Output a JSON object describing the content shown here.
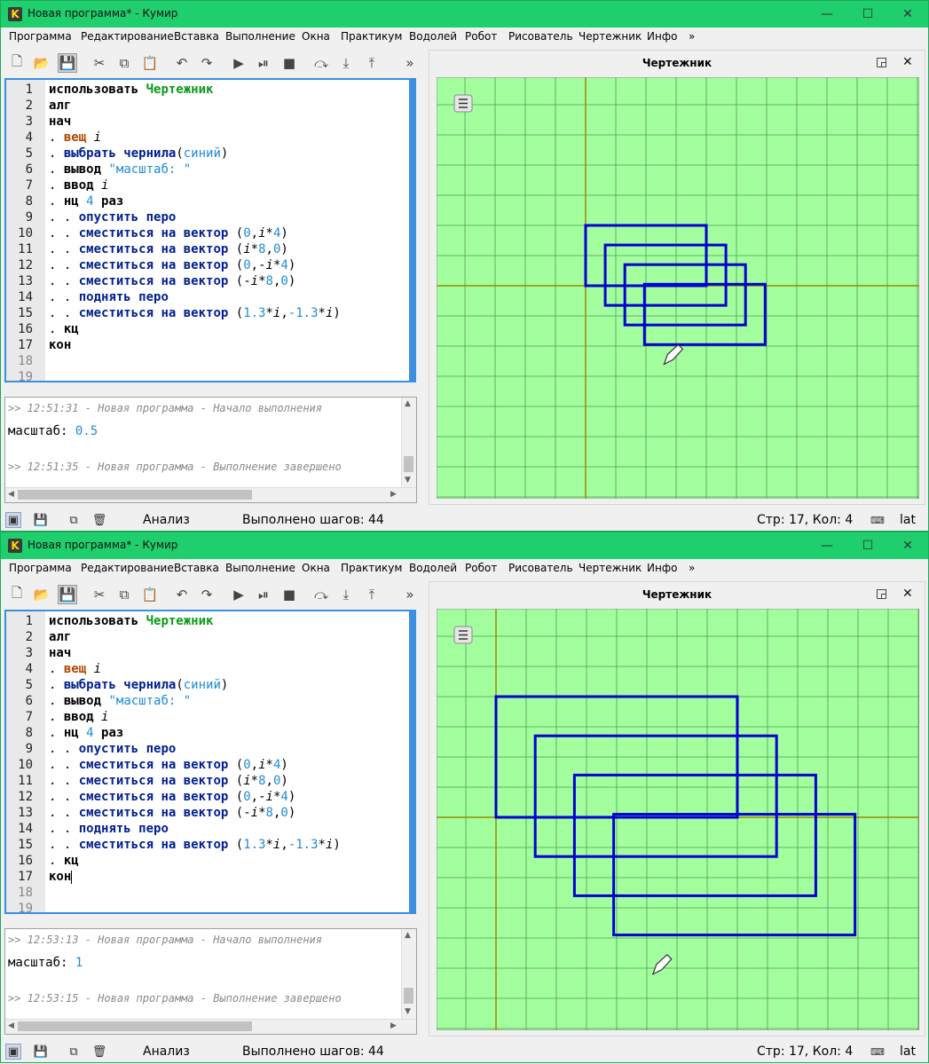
{
  "window_title": "Новая программа* - Кумир",
  "app_icon_letter": "K",
  "window_controls": {
    "minimize": "—",
    "maximize": "☐",
    "close": "✕"
  },
  "menu": [
    "Программа",
    "Редактирование",
    "Вставка",
    "Выполнение",
    "Окна",
    "Практикум",
    "Водолей",
    "Робот",
    "Рисователь",
    "Чертежник",
    "Инфо",
    "»"
  ],
  "toolbar_overflow": "»",
  "line_numbers": [
    "1",
    "2",
    "3",
    "4",
    "5",
    "6",
    "7",
    "8",
    "9",
    "10",
    "11",
    "12",
    "13",
    "14",
    "15",
    "16",
    "17",
    "18",
    "19"
  ],
  "code": {
    "use": "использовать",
    "module": "Чертежник",
    "alg": "алг",
    "nach": "нач",
    "dot": ".",
    "dots": ". .",
    "type_real": "вещ",
    "var_i": "i",
    "pick_ink": "выбрать чернила",
    "ink_color": "синий",
    "print_kw": "вывод",
    "print_str": "\"масштаб: \"",
    "input_kw": "ввод",
    "loop_kw": "нц",
    "loop_count": "4",
    "loop_times": "раз",
    "pen_down": "опустить перо",
    "move_vec": "сместиться на вектор",
    "pen_up": "поднять перо",
    "end_loop": "кц",
    "kon": "кон",
    "n0": "0",
    "n4": "4",
    "n8": "8",
    "n13": "1.3",
    "neg13": "-1.3",
    "paren_open": "(",
    "paren_close": ")",
    "comma": ",",
    "star": "*",
    "minus": "-"
  },
  "runs": [
    {
      "log_start": ">> 12:51:31 - Новая программа - Начало выполнения",
      "output_label": "масштаб:",
      "output_value": "0.5",
      "log_end": ">> 12:51:35 - Новая программа - Выполнение завершено"
    },
    {
      "log_start": ">> 12:53:13 - Новая программа - Начало выполнения",
      "output_label": "масштаб:",
      "output_value": "1",
      "log_end": ">> 12:53:15 - Новая программа - Выполнение завершено"
    }
  ],
  "status": {
    "analysis": "Анализ",
    "steps": "Выполнено шагов: 44",
    "position": "Стр: 17, Кол: 4",
    "lang": "lat"
  },
  "draw_panel": {
    "title": "Чертежник",
    "undock_label": "◲",
    "close_label": "✕",
    "menu_label": "≡",
    "colors": {
      "grid_bg": "#a3ff9e",
      "grid_line": "#4a9e55",
      "axis": "#9a8a00",
      "ink": "#0000d0"
    },
    "scales": [
      0.5,
      1
    ]
  }
}
